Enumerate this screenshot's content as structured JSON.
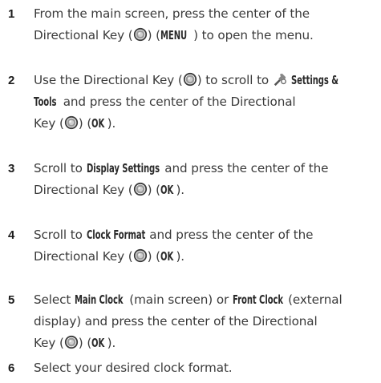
{
  "steps": [
    {
      "num": "1",
      "l1a": "From the main screen, press the center of the",
      "l2a": "Directional Key (",
      "l2b": ") (",
      "l2c": "MENU",
      "l2d": ") to open the menu."
    },
    {
      "num": "2",
      "l1a": "Use the Directional Key (",
      "l1b": ") to scroll to ",
      "l1c": "Settings &",
      "l2a": "Tools",
      "l2b": " and press the center of the Directional",
      "l3a": "Key (",
      "l3b": ") (",
      "l3c": "OK",
      "l3d": ")."
    },
    {
      "num": "3",
      "l1a": "Scroll to ",
      "l1b": "Display Settings",
      "l1c": " and press the center of the",
      "l2a": "Directional Key (",
      "l2b": ") (",
      "l2c": "OK",
      "l2d": ")."
    },
    {
      "num": "4",
      "l1a": "Scroll to ",
      "l1b": "Clock Format",
      "l1c": " and press the center of the",
      "l2a": "Directional Key (",
      "l2b": ") (",
      "l2c": "OK",
      "l2d": ")."
    },
    {
      "num": "5",
      "l1a": "Select ",
      "l1b": "Main Clock",
      "l1c": " (main screen) or ",
      "l1d": "Front Clock",
      "l1e": " (external",
      "l2a": "display) and press the center of the Directional",
      "l3a": "Key (",
      "l3b": ") (",
      "l3c": "OK",
      "l3d": ")."
    },
    {
      "num": "6",
      "l1a": "Select your desired clock format."
    }
  ],
  "icons": {
    "key": "directional-key-icon",
    "tools": "settings-tools-icon"
  }
}
